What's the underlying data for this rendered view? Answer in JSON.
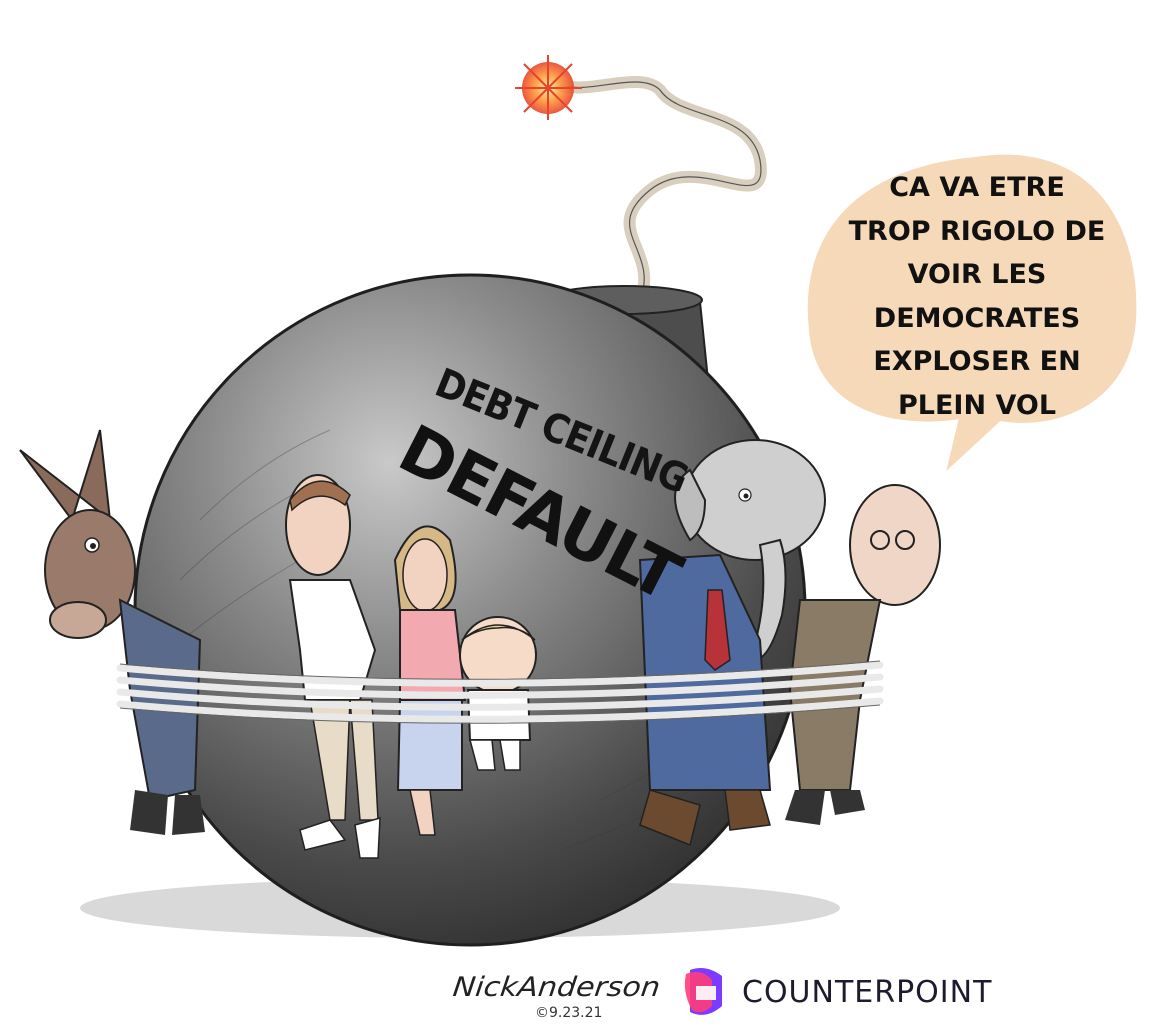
{
  "speech_bubble": {
    "lines": [
      "CA VA ETRE",
      "TROP RIGOLO DE",
      "VOIR LES",
      "DEMOCRATES",
      "EXPLOSER EN",
      "PLEIN VOL"
    ],
    "fill_color": "#f6d9b8"
  },
  "bomb": {
    "label_line1": "DEBT CEILING",
    "label_line2": "DEFAULT"
  },
  "signature": {
    "name": "NickAnderson",
    "date": "©9.23.21"
  },
  "brand": {
    "name": "COUNTERPOINT",
    "colors": [
      "#ff3c7a",
      "#7b3cff"
    ]
  }
}
